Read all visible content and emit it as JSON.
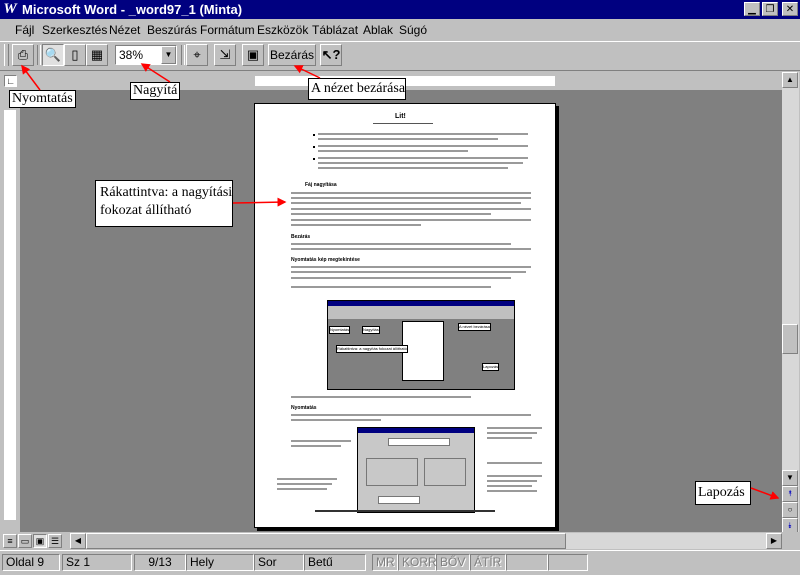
{
  "window": {
    "title": "Microsoft Word - _word97_1 (Minta)",
    "app_icon": "word-icon",
    "controls": [
      "minimize-icon",
      "restore-icon",
      "close-icon"
    ]
  },
  "menu": {
    "items": [
      "Fájl",
      "Szerkesztés",
      "Nézet",
      "Beszúrás",
      "Formátum",
      "Eszközök",
      "Táblázat",
      "Ablak",
      "Súgó"
    ]
  },
  "toolbar": {
    "zoom_value": "38%",
    "close_label": "Bezárás",
    "buttons": [
      "print-icon",
      "magnifier-icon",
      "one-page-icon",
      "multiple-pages-icon",
      "view-ruler-icon",
      "shrink-to-fit-icon",
      "full-screen-icon",
      "context-help-icon"
    ]
  },
  "callouts": {
    "print": "Nyomtatás",
    "zoom": "Nagyítá",
    "close_view": "A nézet bezárása",
    "click_zoom_line1": "Rákattintva: a nagyítási",
    "click_zoom_line2": "fokozat állítható",
    "paging": "Lapozás"
  },
  "page_preview": {
    "heading": "Lit!",
    "section_headings": [
      "Fáj nagyítása",
      "Bezárás",
      "Nyomtatás kép megtekintése",
      "Nyomtatás"
    ],
    "embedded_labels": [
      "Nyomtatás",
      "Nagyítás",
      "A nézet bezárása",
      "Rákattintva: a nagyítás fokozat állítható",
      "Lapozás"
    ]
  },
  "status": {
    "page": "Oldal  9",
    "section": "Sz  1",
    "pages": "9/13",
    "at": "Hely",
    "line": "Sor",
    "col": "Betű",
    "rec": "MR",
    "trk": "KORR",
    "ext": "BŐV",
    "ovr": "ÁTÍR"
  },
  "colors": {
    "titlebar": "#000080",
    "face": "#c0c0c0",
    "preview_bg": "#808080",
    "arrow": "#ff0000"
  }
}
